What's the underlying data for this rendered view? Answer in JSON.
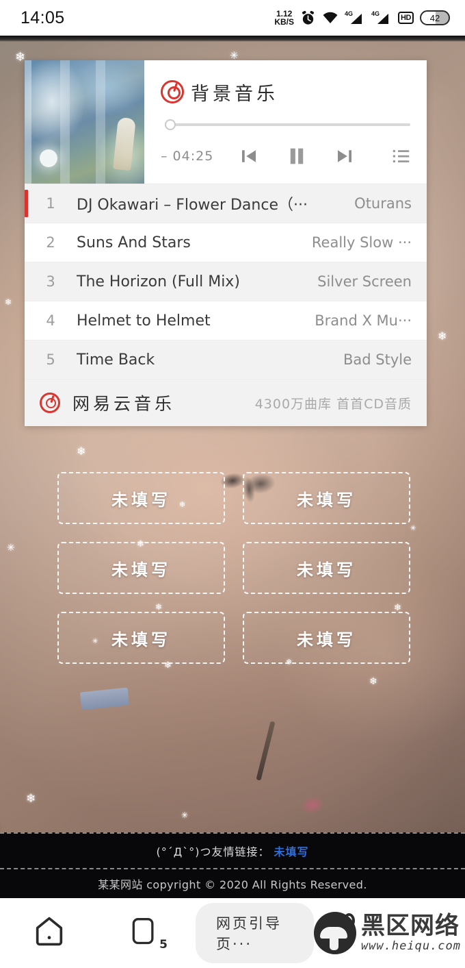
{
  "status_bar": {
    "clock": "14:05",
    "net_speed_value": "1.12",
    "net_speed_unit": "KB/S",
    "signal_label_1": "4G",
    "signal_label_2": "4G",
    "hd_label": "HD",
    "battery": "42"
  },
  "music_card": {
    "brand_title": "背景音乐",
    "time_display": "– 04:25",
    "progress_percent": 0,
    "footer_brand": "网易云音乐",
    "footer_slogan": "4300万曲库 首首CD音质",
    "tracks": [
      {
        "index": "1",
        "title": "DJ Okawari – Flower Dance（···",
        "artist": "Oturans",
        "active": true
      },
      {
        "index": "2",
        "title": "Suns And Stars",
        "artist": "Really Slow ···",
        "active": false
      },
      {
        "index": "3",
        "title": "The Horizon (Full Mix)",
        "artist": "Silver Screen",
        "active": false
      },
      {
        "index": "4",
        "title": "Helmet to Helmet",
        "artist": "Brand X Mu···",
        "active": false
      },
      {
        "index": "5",
        "title": "Time Back",
        "artist": "Bad Style",
        "active": false
      }
    ]
  },
  "grid_buttons": [
    {
      "label": "未填写"
    },
    {
      "label": "未填写"
    },
    {
      "label": "未填写"
    },
    {
      "label": "未填写"
    },
    {
      "label": "未填写"
    },
    {
      "label": "未填写"
    }
  ],
  "site_footer": {
    "links_prefix": "(°´Д`°)つ友情链接：",
    "links_value": "未填写",
    "copyright": "某某网站 copyright © 2020 All Rights Reserved."
  },
  "nav_bar": {
    "tabs_count": "5",
    "pill_label": "网页引导页···",
    "watermark_cn": "黑区网络",
    "watermark_url": "www.heiqu.com"
  },
  "colors": {
    "accent_red": "#d8332e",
    "link_blue": "#2f6ed8",
    "row_alt": "#f2f2f2"
  }
}
